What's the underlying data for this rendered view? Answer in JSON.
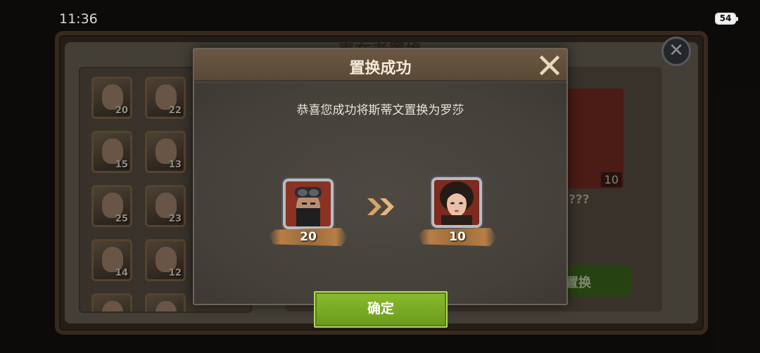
{
  "status_bar": {
    "time": "11:36",
    "battery": "54"
  },
  "background": {
    "title": "表在者置换",
    "hero_levels": [
      "20",
      "22",
      "15",
      "13",
      "25",
      "23",
      "14",
      "12"
    ],
    "target_card_level": "10",
    "target_name": "???",
    "action_button": "置换"
  },
  "dialog": {
    "title": "置换成功",
    "message": "恭喜您成功将斯蒂文置换为罗莎",
    "from_hero": {
      "count": "20"
    },
    "to_hero": {
      "count": "10"
    },
    "confirm_label": "确定"
  },
  "colors": {
    "accent_green": "#7aab22",
    "ribbon": "#b67f46",
    "header": "#5f4e3a"
  }
}
